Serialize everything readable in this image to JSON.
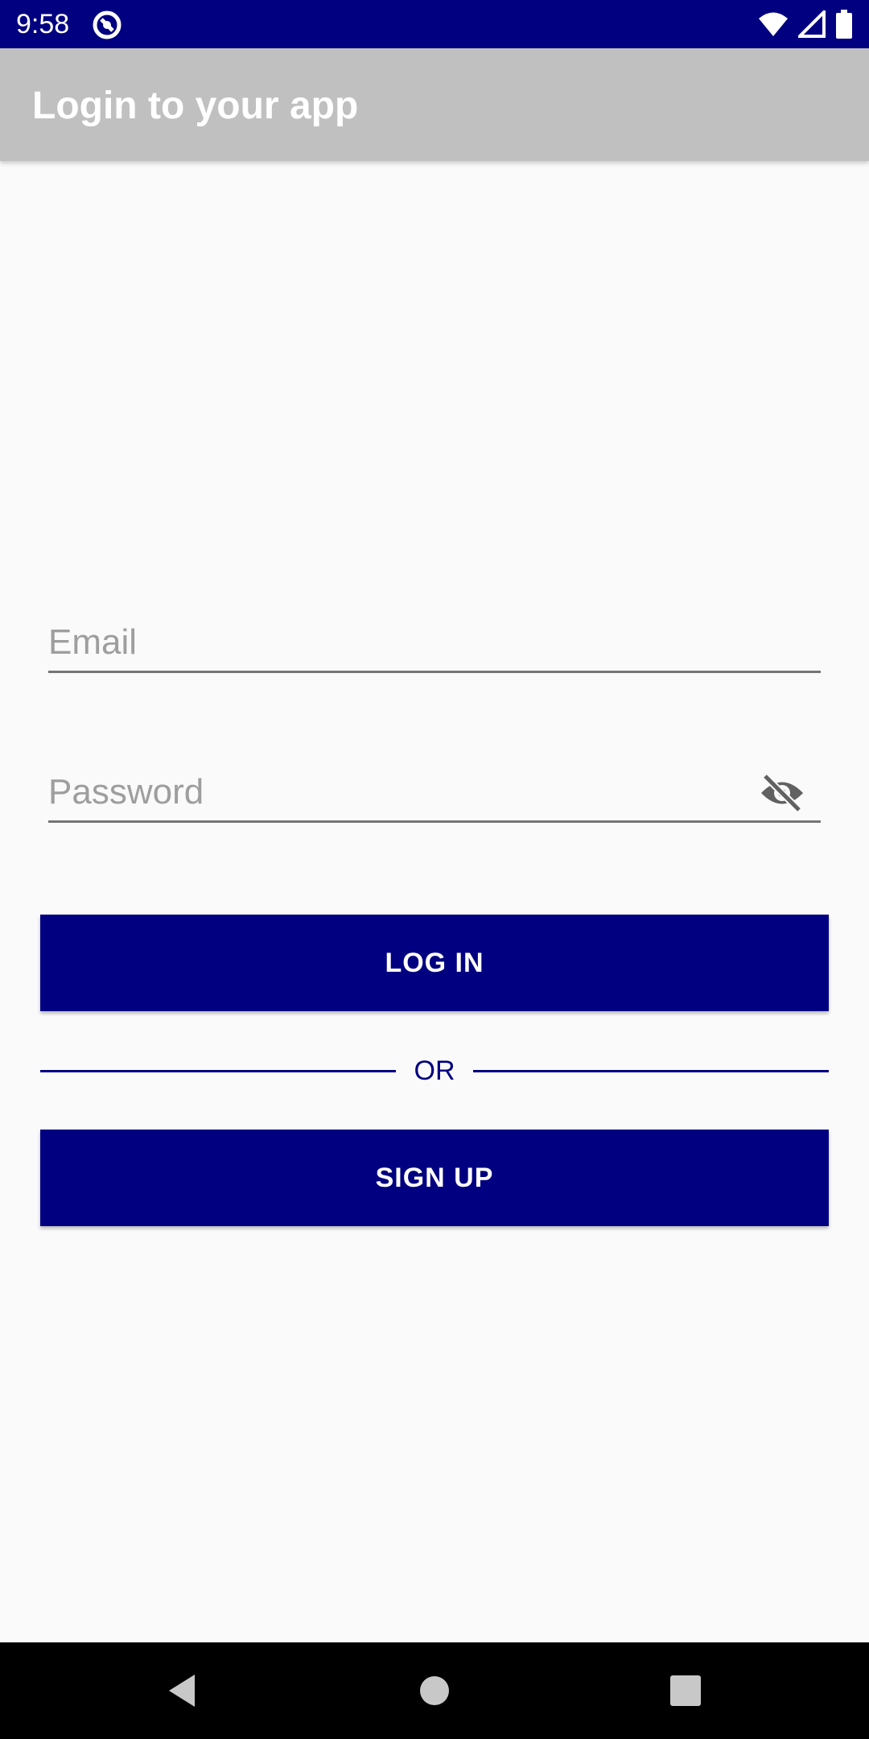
{
  "status_bar": {
    "time": "9:58",
    "icons": [
      "app-notification-icon",
      "wifi-icon",
      "cell-signal-icon",
      "battery-icon"
    ],
    "background": "#000080"
  },
  "app_bar": {
    "title": "Login to your app",
    "background": "#c0c0c0"
  },
  "form": {
    "email": {
      "value": "",
      "placeholder": "Email"
    },
    "password": {
      "value": "",
      "placeholder": "Password",
      "toggle_icon": "visibility-off-icon"
    },
    "login_label": "LOG IN",
    "divider_label": "OR",
    "signup_label": "SIGN UP",
    "accent": "#000080"
  },
  "nav_bar": {
    "buttons": [
      "back-icon",
      "home-icon",
      "recents-icon"
    ]
  }
}
